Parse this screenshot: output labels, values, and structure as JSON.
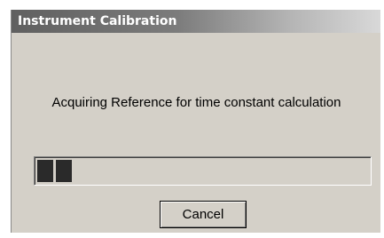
{
  "window": {
    "title": "Instrument Calibration"
  },
  "message": "Acquiring Reference for time constant calculation",
  "progress": {
    "percent": 11
  },
  "buttons": {
    "cancel_label": "Cancel"
  }
}
